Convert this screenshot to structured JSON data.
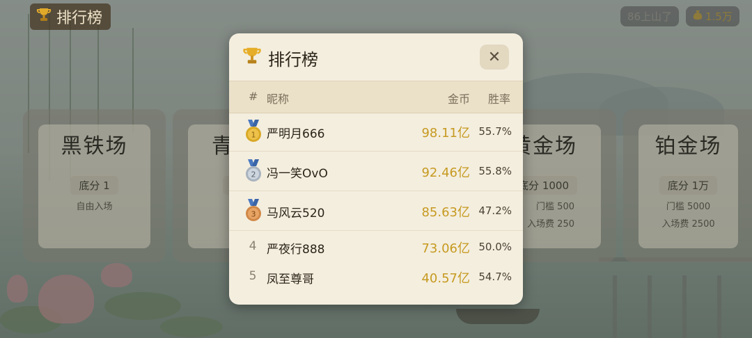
{
  "topbar": {
    "rank_label": "排行榜",
    "level_text": "86上山了",
    "coins_text": "1.5万"
  },
  "venues": [
    {
      "name": "黑铁场",
      "base": "底分 1",
      "line1": "自由入场",
      "line2": ""
    },
    {
      "name": "青",
      "base": "底",
      "line1": "",
      "line2": ""
    },
    {
      "name": "黄金场",
      "base": "底分 1000",
      "line1": "门槛 500",
      "line2": "入场费 250"
    },
    {
      "name": "铂金场",
      "base": "底分 1万",
      "line1": "门槛 5000",
      "line2": "入场费 2500"
    }
  ],
  "leaderboard": {
    "title": "排行榜",
    "columns": {
      "rank": "#",
      "nickname": "昵称",
      "coins": "金币",
      "winrate": "胜率"
    },
    "rows": [
      {
        "rank": "1",
        "nickname": "严明月666",
        "coins": "98.11亿",
        "winrate": "55.7%",
        "medal": "gold"
      },
      {
        "rank": "2",
        "nickname": "冯一笑OvO",
        "coins": "92.46亿",
        "winrate": "55.8%",
        "medal": "silver"
      },
      {
        "rank": "3",
        "nickname": "马风云520",
        "coins": "85.63亿",
        "winrate": "47.2%",
        "medal": "bronze"
      },
      {
        "rank": "4",
        "nickname": "严夜行888",
        "coins": "73.06亿",
        "winrate": "50.0%",
        "medal": ""
      },
      {
        "rank": "5",
        "nickname": "凤至尊哥",
        "coins": "40.57亿",
        "winrate": "54.7%",
        "medal": ""
      }
    ]
  },
  "colors": {
    "gold": "#d8a928",
    "silver": "#a9b3bf",
    "bronze": "#d08848",
    "ribbon": "#4a78c0",
    "coin_text": "#c69a20"
  }
}
